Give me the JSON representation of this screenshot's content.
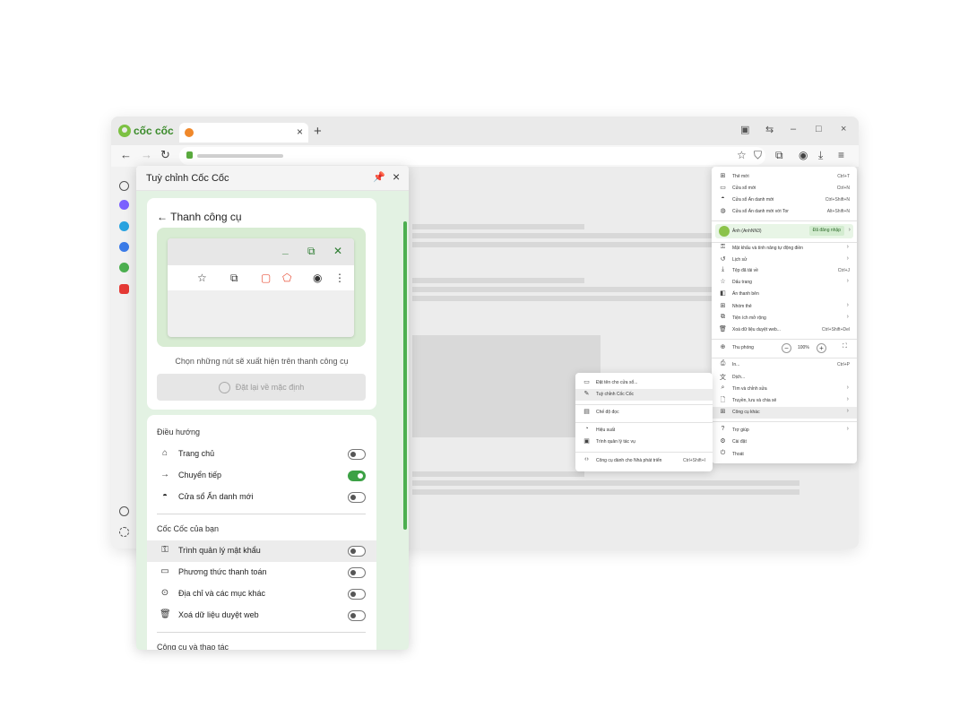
{
  "browser": {
    "logo_text": "cốc cốc",
    "tab": {
      "close_glyph": "×"
    },
    "new_tab_glyph": "+",
    "window_controls": [
      "–",
      "□",
      "×"
    ],
    "brand_green": "#4caf50",
    "accent_orange": "#f0882a"
  },
  "panel": {
    "title": "Tuỳ chỉnh Cốc Cốc",
    "back_label": "← Thanh công cụ",
    "hint": "Chọn những nút sẽ xuất hiện trên thanh công cụ",
    "reset_label": "Đặt lại về mặc định",
    "sections": [
      {
        "title": "Điều hướng",
        "items": [
          {
            "label": "Trang chủ",
            "icon": "home-icon",
            "enabled": false
          },
          {
            "label": "Chuyển tiếp",
            "icon": "arrow-right-icon",
            "enabled": true
          },
          {
            "label": "Cửa sổ Ẩn danh mới",
            "icon": "incognito-icon",
            "enabled": false
          }
        ]
      },
      {
        "title": "Cốc Cốc của bạn",
        "items": [
          {
            "label": "Trình quản lý mật khẩu",
            "icon": "key-icon",
            "enabled": false
          },
          {
            "label": "Phương thức thanh toán",
            "icon": "card-icon",
            "enabled": false
          },
          {
            "label": "Địa chỉ và các mục khác",
            "icon": "location-icon",
            "enabled": false
          },
          {
            "label": "Xoá dữ liệu duyệt web",
            "icon": "trash-icon",
            "enabled": false
          }
        ]
      },
      {
        "title": "Công cụ và thao tác"
      }
    ]
  },
  "menu": {
    "items_top": [
      {
        "label": "Thẻ mới",
        "shortcut": "Ctrl+T"
      },
      {
        "label": "Cửa sổ mới",
        "shortcut": "Ctrl+N"
      },
      {
        "label": "Cửa sổ Ẩn danh mới",
        "shortcut": "Ctrl+Shift+N"
      },
      {
        "label": "Cửa sổ Ẩn danh mới với Tor",
        "shortcut": "Alt+Shift+N"
      }
    ],
    "profile": {
      "name": "Ảnh (AnhNN3)",
      "status": "Đã đăng nhập"
    },
    "items_mid": [
      {
        "label": "Mật khẩu và tính năng tự động điền",
        "arrow": true
      },
      {
        "label": "Lịch sử",
        "arrow": true
      },
      {
        "label": "Tệp đã tải về",
        "shortcut": "Ctrl+J"
      },
      {
        "label": "Dấu trang",
        "arrow": true
      },
      {
        "label": "Ẩn thanh bên"
      },
      {
        "label": "Nhóm thẻ",
        "arrow": true
      },
      {
        "label": "Tiện ích mở rộng",
        "arrow": true
      },
      {
        "label": "Xoá dữ liệu duyệt web...",
        "shortcut": "Ctrl+Shift+Del"
      }
    ],
    "zoom": {
      "label": "Thu phóng",
      "value": "100%",
      "minus": "−",
      "plus": "+"
    },
    "items_tools": [
      {
        "label": "In...",
        "shortcut": "Ctrl+P"
      },
      {
        "label": "Dịch..."
      },
      {
        "label": "Tìm và chỉnh sửa",
        "arrow": true
      },
      {
        "label": "Truyền, lưu và chia sẻ",
        "arrow": true
      },
      {
        "label": "Công cụ khác",
        "arrow": true
      }
    ],
    "items_bottom": [
      {
        "label": "Trợ giúp",
        "arrow": true
      },
      {
        "label": "Cài đặt"
      },
      {
        "label": "Thoát"
      }
    ]
  },
  "submenu": {
    "group1": [
      "Đặt tên cho cửa sổ...",
      "Tuỳ chỉnh Cốc Cốc"
    ],
    "group2": [
      "Chế độ đọc"
    ],
    "group3": [
      "Hiệu suất",
      "Trình quản lý tác vụ"
    ],
    "group4": {
      "label": "Công cụ dành cho Nhà phát triển",
      "shortcut": "Ctrl+Shift+I"
    }
  }
}
